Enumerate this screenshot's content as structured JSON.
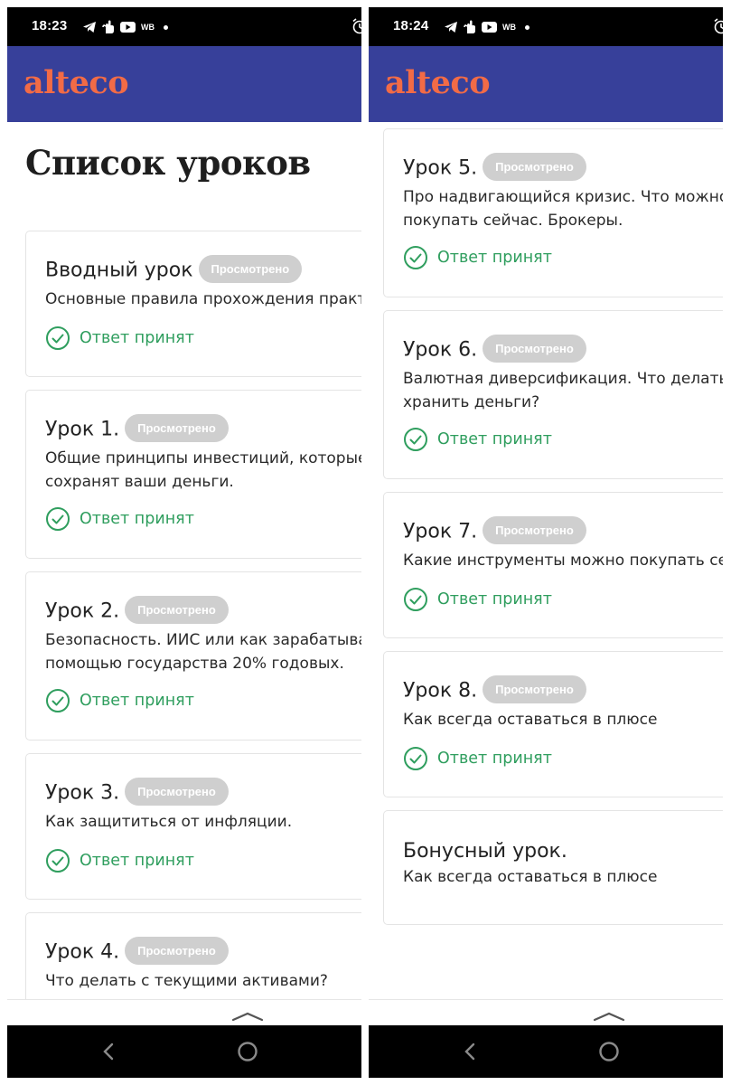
{
  "app": {
    "logo": "alteco",
    "page_title": "Список уроков",
    "brand_color": "#37409a",
    "logo_color": "#f26b46",
    "status_color": "#2f9e5e"
  },
  "badge_label": "Просмотрено",
  "status_label": "Ответ принят",
  "screens": [
    {
      "time": "18:23",
      "network": "WB",
      "lessons": [
        {
          "title": "Вводный урок",
          "desc": [
            "Основные правила прохождения практ"
          ]
        },
        {
          "title": "Урок 1.",
          "desc": [
            "Общие принципы инвестиций, которые",
            "сохранят ваши деньги."
          ]
        },
        {
          "title": "Урок 2.",
          "desc": [
            "Безопасность. ИИС или как зарабатыва",
            "помощью государства 20% годовых."
          ]
        },
        {
          "title": "Урок 3.",
          "desc": [
            "Как защититься от инфляции."
          ]
        },
        {
          "title": "Урок 4.",
          "desc": [
            "Что делать с текущими активами?"
          ]
        }
      ]
    },
    {
      "time": "18:24",
      "network": "WB",
      "lessons": [
        {
          "title": "Урок 5.",
          "desc": [
            "Про надвигающийся кризис. Что можно",
            "покупать сейчас. Брокеры."
          ]
        },
        {
          "title": "Урок 6.",
          "desc": [
            "Валютная диверсификация. Что делать",
            "хранить деньги?"
          ]
        },
        {
          "title": "Урок 7.",
          "desc": [
            "Какие инструменты можно покупать се"
          ]
        },
        {
          "title": "Урок 8.",
          "desc": [
            "Как всегда оставаться в плюсе"
          ]
        },
        {
          "title": "Бонусный урок.",
          "desc": [
            "Как всегда оставаться в плюсе"
          ]
        }
      ]
    }
  ]
}
